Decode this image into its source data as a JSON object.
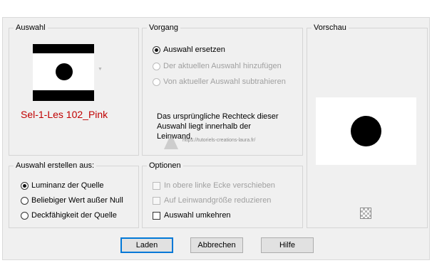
{
  "selection_group": {
    "title": "Auswahl",
    "selection_name": "Sel-1-Les 102_Pink",
    "name_color": "#c00000"
  },
  "operation_group": {
    "title": "Vorgang",
    "options": [
      {
        "label": "Auswahl ersetzen",
        "checked": true,
        "enabled": true
      },
      {
        "label": "Der aktuellen Auswahl hinzufügen",
        "checked": false,
        "enabled": false
      },
      {
        "label": "Von aktueller Auswahl subtrahieren",
        "checked": false,
        "enabled": false
      }
    ],
    "info_text": "Das ursprüngliche Rechteck dieser Auswahl liegt innerhalb der Leinwand.",
    "watermark_text": "https://tutoriels-creations-laura.fr/"
  },
  "preview_group": {
    "title": "Vorschau",
    "checker_icon": "checkerboard-icon"
  },
  "create_from_group": {
    "title": "Auswahl erstellen aus:",
    "options": [
      {
        "label": "Luminanz der Quelle",
        "checked": true
      },
      {
        "label": "Beliebiger Wert außer Null",
        "checked": false
      },
      {
        "label": "Deckfähigkeit der Quelle",
        "checked": false
      }
    ]
  },
  "options_group": {
    "title": "Optionen",
    "checkboxes": [
      {
        "label": "In obere linke Ecke verschieben",
        "checked": false,
        "enabled": false
      },
      {
        "label": "Auf Leinwandgröße reduzieren",
        "checked": false,
        "enabled": false
      },
      {
        "label": "Auswahl umkehren",
        "checked": false,
        "enabled": true
      }
    ]
  },
  "buttons": {
    "load": "Laden",
    "cancel": "Abbrechen",
    "help": "Hilfe"
  },
  "colors": {
    "dialog_bg": "#f0f0f0",
    "default_button_border": "#0078d7"
  }
}
